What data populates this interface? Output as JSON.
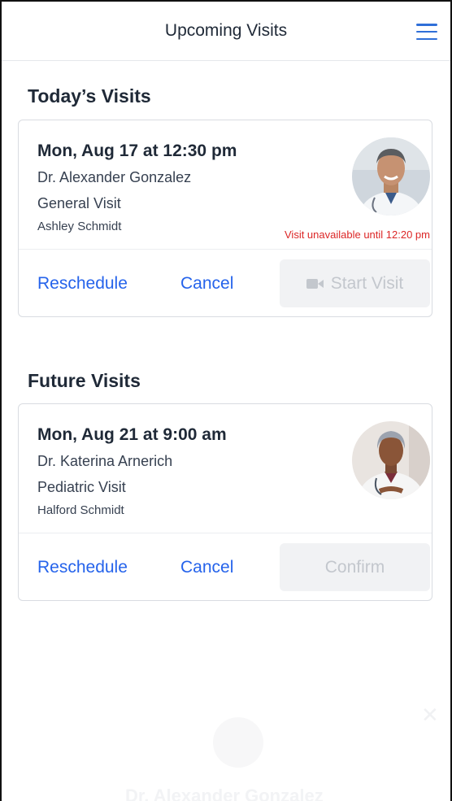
{
  "header": {
    "title": "Upcoming Visits",
    "menu_icon": "hamburger-menu-icon"
  },
  "sections": {
    "today": {
      "title": "Today’s Visits",
      "visit": {
        "datetime": "Mon, Aug 17 at 12:30 pm",
        "doctor": "Dr. Alexander Gonzalez",
        "visit_type": "General Visit",
        "patient": "Ashley Schmidt",
        "status": "Visit unavailable until 12:20 pm",
        "reschedule_label": "Reschedule",
        "cancel_label": "Cancel",
        "primary_label": "Start Visit",
        "primary_icon": "video-camera-icon"
      }
    },
    "future": {
      "title": "Future Visits",
      "visit": {
        "datetime": "Mon, Aug 21 at 9:00 am",
        "doctor": "Dr. Katerina Arnerich",
        "visit_type": "Pediatric Visit",
        "patient": "Halford Schmidt",
        "reschedule_label": "Reschedule",
        "cancel_label": "Cancel",
        "primary_label": "Confirm"
      }
    }
  },
  "background_panel": {
    "doctor_name": "Dr. Alexander Gonzalez",
    "close_icon": "close-icon"
  },
  "colors": {
    "link": "#2563eb",
    "accent": "#2f6fd8",
    "warning": "#dc2626",
    "disabled_bg": "#f1f2f4",
    "disabled_text": "#c3c7cd"
  }
}
